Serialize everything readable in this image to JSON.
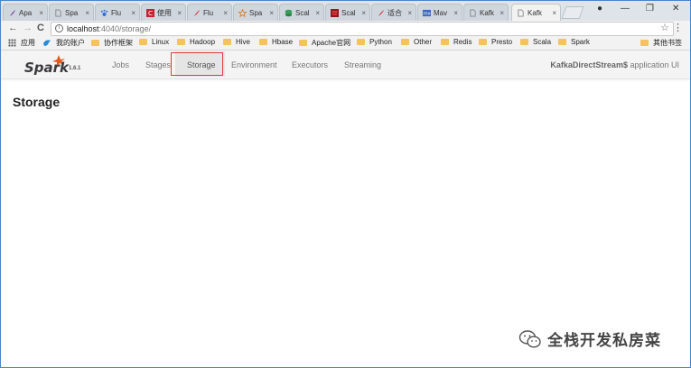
{
  "browser": {
    "tabs": [
      {
        "label": "Apa",
        "icon": "feather-icon",
        "color": "#7b3fa0"
      },
      {
        "label": "Spa",
        "icon": "page-icon",
        "color": "#888888"
      },
      {
        "label": "Flu",
        "icon": "paw-icon",
        "color": "#2f6fd6"
      },
      {
        "label": "使用",
        "icon": "c-icon",
        "color": "#c8202e"
      },
      {
        "label": "Flu",
        "icon": "feather-icon",
        "color": "#d04040"
      },
      {
        "label": "Spa",
        "icon": "star-icon",
        "color": "#e07a1a"
      },
      {
        "label": "Scal",
        "icon": "db-icon",
        "color": "#38a05a"
      },
      {
        "label": "Scal",
        "icon": "scala-icon",
        "color": "#c0282e"
      },
      {
        "label": "适合",
        "icon": "feather-icon",
        "color": "#d04040"
      },
      {
        "label": "Mav",
        "icon": "mvn-icon",
        "color": "#3b66c2"
      },
      {
        "label": "Kafk",
        "icon": "page-icon",
        "color": "#888888"
      },
      {
        "label": "Kafk",
        "icon": "page-icon",
        "color": "#888888",
        "active": true
      }
    ],
    "tab_close": "×",
    "window_controls": {
      "account": "●",
      "minimize": "—",
      "restore": "❐",
      "close": "✕"
    },
    "nav": {
      "back": "←",
      "forward": "→",
      "reload": "C"
    },
    "url": {
      "host": "localhost",
      "path": ":4040/storage/"
    },
    "info_icon": "i",
    "star": "☆",
    "menu": "⋮",
    "bookmarks": [
      {
        "label": "应用",
        "type": "apps"
      },
      {
        "label": "我的账户",
        "type": "bird"
      },
      {
        "label": "协作框架",
        "type": "folder"
      },
      {
        "label": "Linux",
        "type": "folder"
      },
      {
        "label": "Hadoop",
        "type": "folder"
      },
      {
        "label": "Hive",
        "type": "folder"
      },
      {
        "label": "Hbase",
        "type": "folder"
      },
      {
        "label": "Apache官网",
        "type": "folder"
      },
      {
        "label": "Python",
        "type": "folder"
      },
      {
        "label": "Other",
        "type": "folder"
      },
      {
        "label": "Redis",
        "type": "folder"
      },
      {
        "label": "Presto",
        "type": "folder"
      },
      {
        "label": "Scala",
        "type": "folder"
      },
      {
        "label": "Spark",
        "type": "folder"
      }
    ],
    "other_bookmarks": "其他书签"
  },
  "spark": {
    "logo_text": "Spark",
    "version": "1.6.1",
    "nav": [
      "Jobs",
      "Stages",
      "Storage",
      "Environment",
      "Executors",
      "Streaming"
    ],
    "active": "Storage",
    "app_name": "KafkaDirectStream$",
    "app_suffix": " application UI",
    "colors": {
      "logo_orange": "#e25a1c",
      "logo_text": "#3c3a3e",
      "highlight": "#e03c3c"
    }
  },
  "page": {
    "title": "Storage"
  },
  "watermark": {
    "text": "全栈开发私房菜"
  }
}
